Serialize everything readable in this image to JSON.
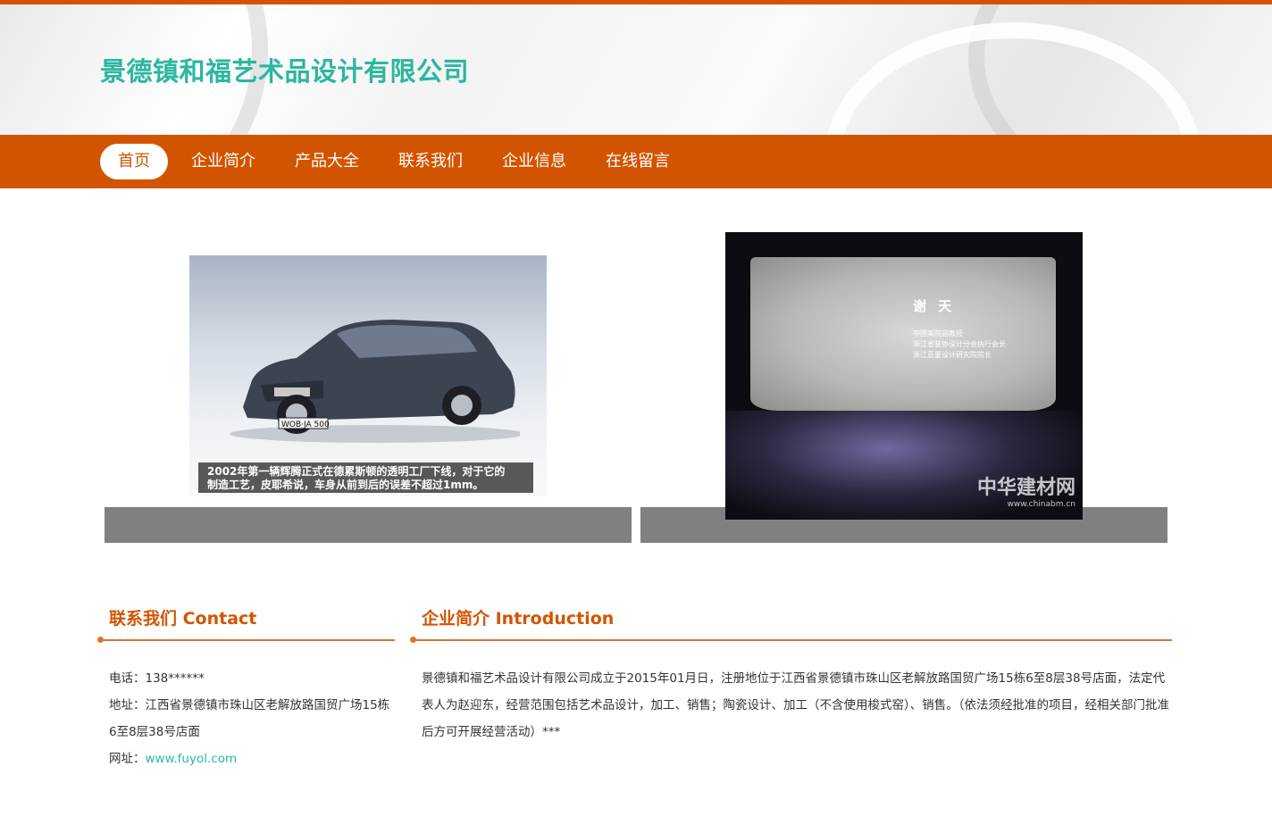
{
  "site": {
    "title": "景德镇和福艺术品设计有限公司"
  },
  "nav": {
    "items": [
      {
        "label": "首页",
        "active": true
      },
      {
        "label": "企业简介",
        "active": false
      },
      {
        "label": "产品大全",
        "active": false
      },
      {
        "label": "联系我们",
        "active": false
      },
      {
        "label": "企业信息",
        "active": false
      },
      {
        "label": "在线留言",
        "active": false
      }
    ]
  },
  "gallery": {
    "car_caption_line1": "2002年第一辆辉腾正式在德累斯顿的透明工厂下线，对于它的",
    "car_caption_line2": "制造工艺，皮耶希说，车身从前到后的误差不超过1mm。",
    "car_plate": "WOB·JA 500",
    "cinema_name": "谢  天",
    "cinema_line1": "中国美院副教授",
    "cinema_line2": "浙江省装协设计分会执行会长",
    "cinema_line3": "浙江亚厦设计研究院院长",
    "watermark_main": "中华建材网",
    "watermark_url": "www.chinabm.cn"
  },
  "contact": {
    "title": "联系我们 Contact",
    "phone_label": "电话：",
    "phone": "138******",
    "address_label": "地址：",
    "address": "江西省景德镇市珠山区老解放路国贸广场15栋6至8层38号店面",
    "website_label": "网址：",
    "website": "www.fuyol.com"
  },
  "intro": {
    "title": "企业简介 Introduction",
    "text": "景德镇和福艺术品设计有限公司成立于2015年01月日，注册地位于江西省景德镇市珠山区老解放路国贸广场15栋6至8层38号店面，法定代表人为赵迎东，经营范围包括艺术品设计，加工、销售；陶瓷设计、加工（不含使用梭式窑）、销售。（依法须经批准的项目，经相关部门批准后方可开展经营活动）***"
  },
  "colors": {
    "accent": "#d35400",
    "brand_text": "#2bb7a0",
    "caption_bar": "#808080"
  }
}
